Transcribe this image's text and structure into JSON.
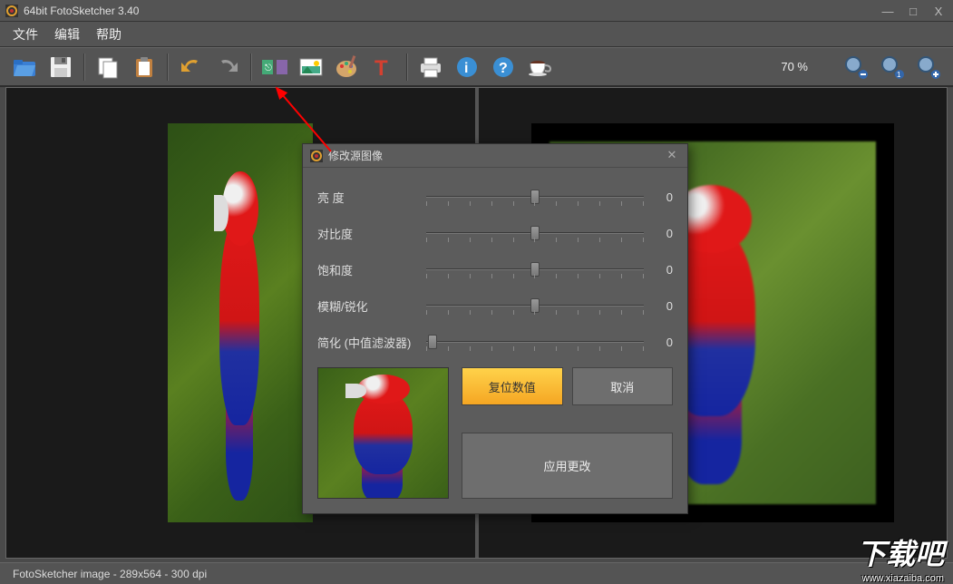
{
  "window": {
    "title": "64bit FotoSketcher 3.40",
    "min": "—",
    "max": "□",
    "close": "X"
  },
  "menu": {
    "file": "文件",
    "edit": "编辑",
    "help": "帮助"
  },
  "toolbar": {
    "open": "open-icon",
    "save": "save-icon",
    "copy": "copy-icon",
    "paste": "paste-icon",
    "undo": "undo-icon",
    "redo": "redo-icon",
    "effects": "effects-icon",
    "source": "source-image-icon",
    "palette": "palette-icon",
    "text": "text-icon",
    "print": "print-icon",
    "info": "info-icon",
    "help": "help-icon",
    "donate": "coffee-icon",
    "zoom_readout": "70 %",
    "zoom_out": "zoom-out-icon",
    "zoom_fit": "zoom-fit-icon",
    "zoom_in": "zoom-in-icon"
  },
  "dialog": {
    "title": "修改源图像",
    "sliders": [
      {
        "label": "亮 度",
        "value": "0",
        "pos": 50
      },
      {
        "label": "对比度",
        "value": "0",
        "pos": 50
      },
      {
        "label": "饱和度",
        "value": "0",
        "pos": 50
      },
      {
        "label": "模糊/锐化",
        "value": "0",
        "pos": 50
      },
      {
        "label": "简化 (中值滤波器)",
        "value": "0",
        "pos": 3
      }
    ],
    "reset": "复位数值",
    "cancel": "取消",
    "apply": "应用更改"
  },
  "status": "FotoSketcher image - 289x564 - 300 dpi",
  "watermark": {
    "logo": "下载吧",
    "url": "www.xiazaiba.com"
  }
}
